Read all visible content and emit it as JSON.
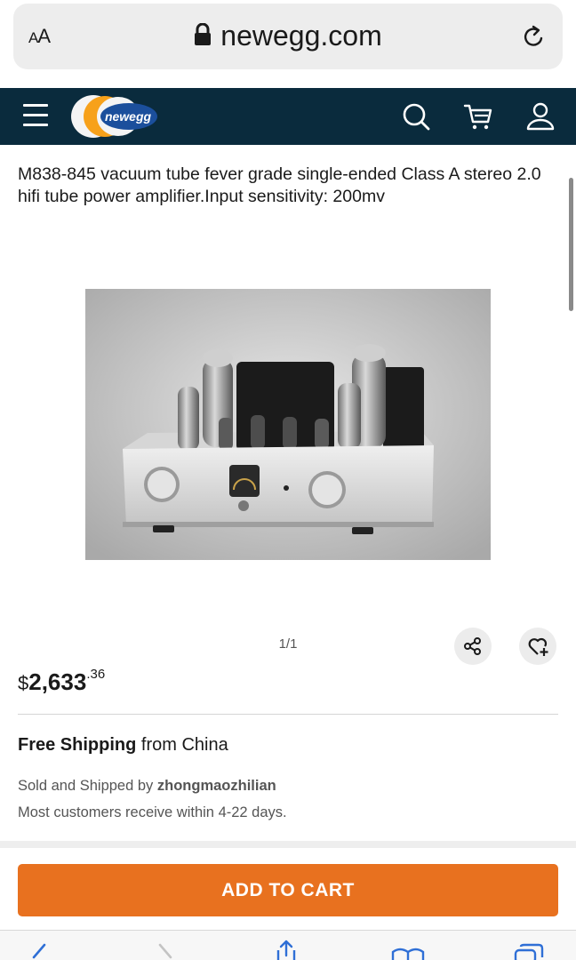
{
  "browser": {
    "text_size_label_small": "A",
    "text_size_label_large": "A",
    "url": "newegg.com"
  },
  "header": {
    "logo_text": "newegg"
  },
  "product": {
    "title": "M838-845 vacuum tube fever grade single-ended Class A stereo 2.0 hifi tube power amplifier.Input sensitivity: 200mv",
    "image_counter": "1/1",
    "price_currency": "$",
    "price_whole": "2,633",
    "price_cents": ".36",
    "shipping_bold": "Free Shipping",
    "shipping_rest": " from China",
    "sold_prefix": "Sold and Shipped by ",
    "seller": "zhongmaozhilian",
    "delivery_note": "Most customers receive within 4-22 days."
  },
  "actions": {
    "add_to_cart": "ADD TO CART"
  },
  "colors": {
    "header_bg": "#0a2b3d",
    "cart_button": "#e8711f",
    "logo_orange": "#f7a11a",
    "logo_blue": "#1b4f9c"
  },
  "icons": {
    "menu": "hamburger-icon",
    "search": "search-icon",
    "cart": "cart-icon",
    "account": "user-icon",
    "share": "share-icon",
    "wishlist": "heart-plus-icon",
    "lock": "lock-icon",
    "reload": "reload-icon"
  }
}
